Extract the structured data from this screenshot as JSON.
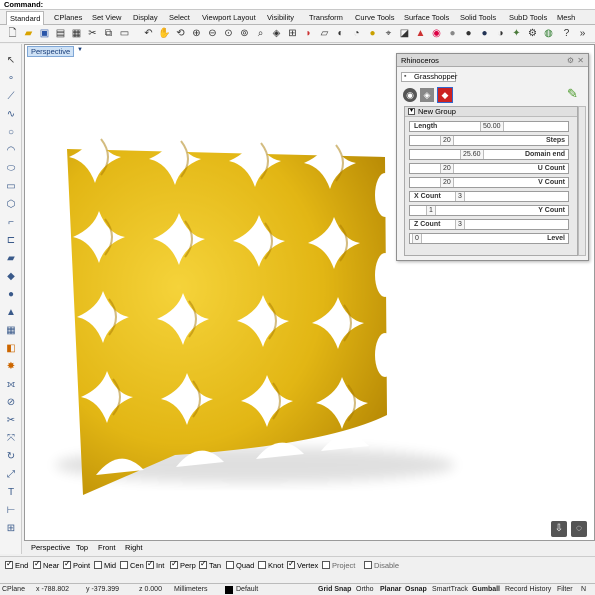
{
  "command": {
    "label": "Command:"
  },
  "menu_tabs": [
    {
      "label": "Standard",
      "active": true
    },
    {
      "label": "CPlanes"
    },
    {
      "label": "Set View"
    },
    {
      "label": "Display"
    },
    {
      "label": "Select"
    },
    {
      "label": "Viewport Layout"
    },
    {
      "label": "Visibility"
    },
    {
      "label": "Transform"
    },
    {
      "label": "Curve Tools"
    },
    {
      "label": "Surface Tools"
    },
    {
      "label": "Solid Tools"
    },
    {
      "label": "SubD Tools"
    },
    {
      "label": "Mesh"
    }
  ],
  "viewport": {
    "title": "Perspective",
    "model_color": "#e8c21a"
  },
  "view_tabs": [
    "Perspective",
    "Top",
    "Front",
    "Right"
  ],
  "osnaps": [
    {
      "label": "End",
      "checked": true
    },
    {
      "label": "Near",
      "checked": true
    },
    {
      "label": "Point",
      "checked": true
    },
    {
      "label": "Mid",
      "checked": false
    },
    {
      "label": "Cen",
      "checked": false
    },
    {
      "label": "Int",
      "checked": true
    },
    {
      "label": "Perp",
      "checked": true
    },
    {
      "label": "Tan",
      "checked": true
    },
    {
      "label": "Quad",
      "checked": false
    },
    {
      "label": "Knot",
      "checked": false
    },
    {
      "label": "Vertex",
      "checked": true
    },
    {
      "label": "Project",
      "checked": false
    },
    {
      "label": "Disable",
      "checked": false
    }
  ],
  "status": {
    "cplane": "CPlane",
    "x": "x -788.802",
    "y": "y -379.399",
    "z": "z 0.000",
    "units": "Millimeters",
    "layer": "Default",
    "grid_snap": "Grid Snap",
    "ortho": "Ortho",
    "planar": "Planar",
    "osnap": "Osnap",
    "smarttrack": "SmartTrack",
    "gumball": "Gumball",
    "record_history": "Record History",
    "filter": "Filter",
    "more": "N"
  },
  "panel": {
    "title": "Rhinoceros",
    "tab": "Grasshopper",
    "group_name": "New Group",
    "rows": [
      {
        "label": "Length",
        "value": "50.00",
        "align": "left"
      },
      {
        "label": "Steps",
        "value": "20",
        "align": "right"
      },
      {
        "label": "Domain end",
        "value": "25.60",
        "align": "right"
      },
      {
        "label": "U Count",
        "value": "20",
        "align": "right"
      },
      {
        "label": "V Count",
        "value": "20",
        "align": "right"
      },
      {
        "label": "X Count",
        "value": "3",
        "align": "left"
      },
      {
        "label": "Y Count",
        "value": "1",
        "align": "right"
      },
      {
        "label": "Z Count",
        "value": "3",
        "align": "left"
      },
      {
        "label": "Level",
        "value": "0",
        "align": "right"
      }
    ]
  }
}
